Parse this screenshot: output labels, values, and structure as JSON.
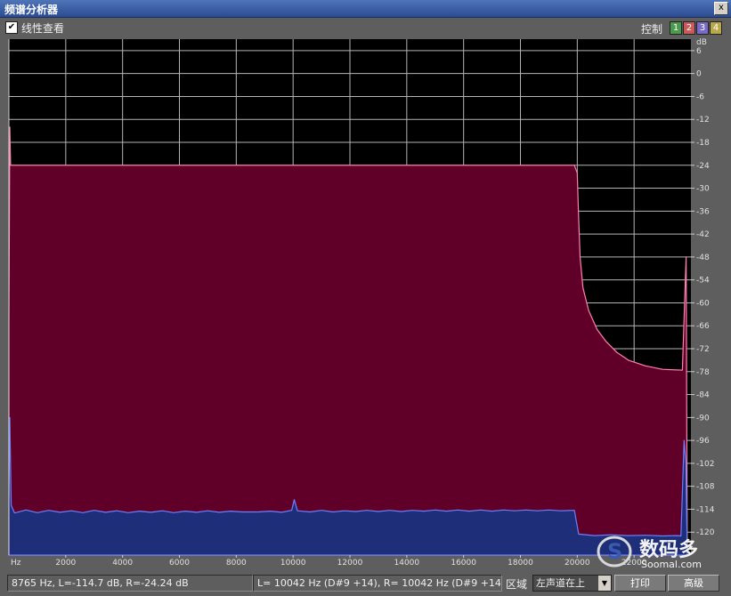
{
  "window": {
    "title": "频谱分析器",
    "close_glyph": "x"
  },
  "toolbar": {
    "linear_view_label": "线性查看",
    "linear_view_checked": true,
    "control_label": "控制",
    "channel_buttons": [
      {
        "label": "1",
        "color": "#4c9a4c"
      },
      {
        "label": "2",
        "color": "#c85a5a"
      },
      {
        "label": "3",
        "color": "#7a6ac8"
      },
      {
        "label": "4",
        "color": "#b8a84a"
      }
    ]
  },
  "chart_data": {
    "type": "area",
    "x_unit_label": "Hz",
    "y_unit_label": "dB",
    "xlim": [
      0,
      24000
    ],
    "ylim": [
      -126,
      9
    ],
    "x_ticks": [
      2000,
      4000,
      6000,
      8000,
      10000,
      12000,
      14000,
      16000,
      18000,
      20000,
      22000
    ],
    "x_tick_labels": [
      "2000",
      "4000",
      "6000",
      "8000",
      "10000",
      "12000",
      "14000",
      "16000",
      "18000",
      "20000",
      "22000"
    ],
    "y_ticks": [
      6,
      0,
      -6,
      -12,
      -18,
      -24,
      -30,
      -36,
      -42,
      -48,
      -54,
      -60,
      -66,
      -72,
      -78,
      -84,
      -90,
      -96,
      -102,
      -108,
      -114,
      -120
    ],
    "y_tick_labels": [
      "6",
      "0",
      "-6",
      "-12",
      "-18",
      "-24",
      "-30",
      "-36",
      "-42",
      "-48",
      "-54",
      "-60",
      "-66",
      "-72",
      "-78",
      "-84",
      "-90",
      "-96",
      "-102",
      "-108",
      "-114",
      "-120"
    ],
    "grid": true,
    "background": "#000000",
    "grid_color": "#b4b4b4",
    "series": [
      {
        "fill": "#600028",
        "stroke": "#ff80b0",
        "points": [
          [
            0,
            -126
          ],
          [
            0,
            -66
          ],
          [
            30,
            -14
          ],
          [
            60,
            -24
          ],
          [
            19900,
            -24
          ],
          [
            20000,
            -26
          ],
          [
            20050,
            -38
          ],
          [
            20100,
            -48
          ],
          [
            20200,
            -56
          ],
          [
            20400,
            -62
          ],
          [
            20700,
            -67
          ],
          [
            21000,
            -70
          ],
          [
            21400,
            -73
          ],
          [
            21800,
            -75
          ],
          [
            22400,
            -76.5
          ],
          [
            23000,
            -77.4
          ],
          [
            23700,
            -77.6
          ],
          [
            23800,
            -55
          ],
          [
            23830,
            -48
          ],
          [
            23870,
            -126
          ]
        ]
      },
      {
        "fill": "#1e2e78",
        "stroke": "#6a80ff",
        "points": [
          [
            0,
            -126
          ],
          [
            0,
            -112
          ],
          [
            30,
            -90
          ],
          [
            80,
            -113
          ],
          [
            200,
            -115
          ],
          [
            600,
            -114.2
          ],
          [
            1000,
            -114.9
          ],
          [
            1400,
            -114.3
          ],
          [
            1800,
            -114.8
          ],
          [
            2200,
            -114.4
          ],
          [
            2600,
            -114.9
          ],
          [
            3000,
            -114.3
          ],
          [
            3400,
            -114.8
          ],
          [
            3800,
            -114.4
          ],
          [
            4200,
            -114.9
          ],
          [
            4600,
            -114.5
          ],
          [
            5000,
            -114.8
          ],
          [
            5400,
            -114.4
          ],
          [
            5800,
            -114.9
          ],
          [
            6200,
            -114.5
          ],
          [
            6600,
            -114.8
          ],
          [
            7000,
            -114.4
          ],
          [
            7400,
            -114.8
          ],
          [
            7800,
            -114.5
          ],
          [
            8200,
            -114.7
          ],
          [
            8765,
            -114.7
          ],
          [
            9200,
            -114.5
          ],
          [
            9600,
            -114.8
          ],
          [
            9950,
            -114.3
          ],
          [
            10042,
            -111.5
          ],
          [
            10150,
            -114.4
          ],
          [
            10600,
            -114.7
          ],
          [
            11000,
            -114.3
          ],
          [
            11400,
            -114.7
          ],
          [
            11800,
            -114.4
          ],
          [
            12200,
            -114.6
          ],
          [
            12600,
            -114.3
          ],
          [
            13000,
            -114.6
          ],
          [
            13400,
            -114.3
          ],
          [
            13800,
            -114.6
          ],
          [
            14200,
            -114.3
          ],
          [
            14600,
            -114.5
          ],
          [
            15000,
            -114.2
          ],
          [
            15400,
            -114.5
          ],
          [
            15800,
            -114.2
          ],
          [
            16200,
            -114.5
          ],
          [
            16600,
            -114.2
          ],
          [
            17000,
            -114.5
          ],
          [
            17400,
            -114.2
          ],
          [
            17800,
            -114.4
          ],
          [
            18200,
            -114.2
          ],
          [
            18600,
            -114.4
          ],
          [
            19000,
            -114.2
          ],
          [
            19400,
            -114.4
          ],
          [
            19900,
            -114.3
          ],
          [
            20050,
            -120.5
          ],
          [
            20600,
            -120.9
          ],
          [
            21200,
            -120.7
          ],
          [
            21800,
            -120.9
          ],
          [
            22400,
            -120.8
          ],
          [
            23000,
            -121.0
          ],
          [
            23500,
            -120.9
          ],
          [
            23650,
            -121
          ],
          [
            23760,
            -96
          ],
          [
            23820,
            -102
          ],
          [
            23870,
            -126
          ]
        ]
      }
    ]
  },
  "status": {
    "cursor_readout": "8765 Hz, L=-114.7 dB, R=-24.24 dB",
    "peak_readout": "L=  10042 Hz (D#9 +14), R=  10042 Hz (D#9 +14)",
    "region_label": "区域",
    "channel_select_value": "左声道在上",
    "print_button": "打印",
    "advanced_button": "高级"
  },
  "watermark": {
    "text": "数码多",
    "domain": "Soomal.com"
  }
}
